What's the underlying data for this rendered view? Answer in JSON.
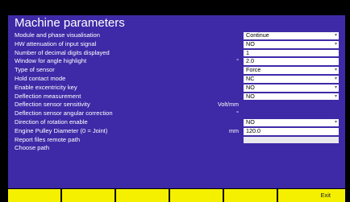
{
  "title": "Machine parameters",
  "rows": [
    {
      "label": "Module and phase visualisation",
      "unit": "",
      "value": "Continue",
      "type": "dropdown"
    },
    {
      "label": "HW attenuation of input signal",
      "unit": "",
      "value": "NO",
      "type": "dropdown"
    },
    {
      "label": "Number of decimal digits displayed",
      "unit": "",
      "value": "1",
      "type": "text"
    },
    {
      "label": "Window for angle highlight",
      "unit": "°",
      "value": "2.0",
      "type": "text"
    },
    {
      "label": "Type of sensor",
      "unit": "",
      "value": "Force",
      "type": "dropdown"
    },
    {
      "label": "Hold contact mode",
      "unit": "",
      "value": "NC",
      "type": "dropdown"
    },
    {
      "label": "Enable excentricity key",
      "unit": "",
      "value": "NO",
      "type": "dropdown"
    },
    {
      "label": "Deflection measurement",
      "unit": "",
      "value": "NO",
      "type": "dropdown"
    },
    {
      "label": "Deflection sensor sensitivity",
      "unit": "Volt/mm",
      "value": "",
      "type": "none"
    },
    {
      "label": "Deflection sensor angular correction",
      "unit": "°",
      "value": "",
      "type": "none"
    },
    {
      "label": "Direction of rotation enable",
      "unit": "",
      "value": "NO",
      "type": "dropdown"
    },
    {
      "label": "Engine Pulley Diameter (0 = Joint)",
      "unit": "mm",
      "value": "120.0",
      "type": "text"
    },
    {
      "label": "Report files remote path",
      "unit": "",
      "value": "",
      "type": "empty"
    },
    {
      "label": "Choose path",
      "unit": "",
      "value": "",
      "type": "none"
    }
  ],
  "function_keys": [
    "",
    "",
    "",
    "",
    "",
    "Exit"
  ]
}
